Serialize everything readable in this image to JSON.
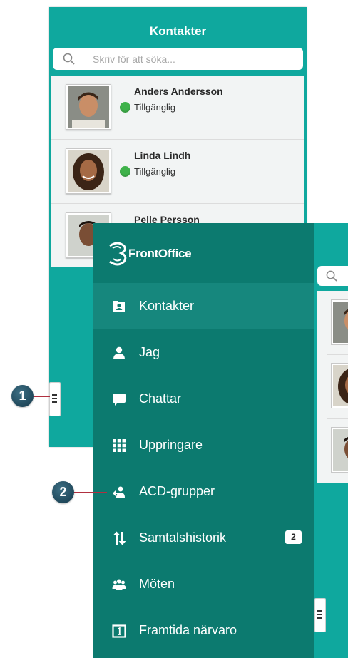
{
  "contacts_screen": {
    "title": "Kontakter",
    "search_placeholder": "Skriv för att söka...",
    "contacts": [
      {
        "name": "Anders Andersson",
        "status": "Tillgänglig"
      },
      {
        "name": "Linda Lindh",
        "status": "Tillgänglig"
      },
      {
        "name": "Pelle Persson",
        "status": ""
      }
    ]
  },
  "menu": {
    "logo_text": "FrontOffice",
    "items": [
      {
        "label": "Kontakter",
        "icon": "contacts-card-icon",
        "active": true
      },
      {
        "label": "Jag",
        "icon": "person-icon"
      },
      {
        "label": "Chattar",
        "icon": "chat-bubble-icon"
      },
      {
        "label": "Uppringare",
        "icon": "keypad-icon"
      },
      {
        "label": "ACD-grupper",
        "icon": "acd-group-icon"
      },
      {
        "label": "Samtalshistorik",
        "icon": "call-history-arrows-icon",
        "badge": "2"
      },
      {
        "label": "Möten",
        "icon": "meeting-people-icon"
      },
      {
        "label": "Framtida närvaro",
        "icon": "calendar-icon"
      }
    ]
  },
  "callouts": [
    "1",
    "2"
  ],
  "colors": {
    "teal": "#0fa89e",
    "menu_bg": "#0c7a6f",
    "menu_active": "#16877d",
    "status_green": "#3fb24a",
    "callout": "#1e4a5e",
    "callout_line": "#b03040"
  }
}
